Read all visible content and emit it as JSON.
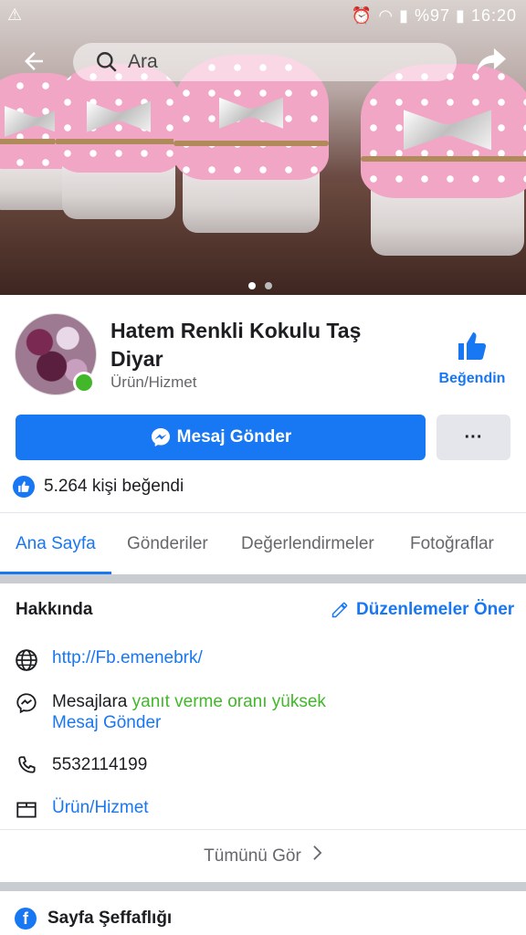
{
  "status_bar": {
    "warning_icon": "⚠",
    "battery": "%97",
    "time": "16:20"
  },
  "search": {
    "placeholder": "Ara"
  },
  "page": {
    "name": "Hatem Renkli Kokulu Taş Diyar",
    "category": "Ürün/Hizmet",
    "liked_label": "Beğendin",
    "message_button": "Mesaj Gönder",
    "more_button": "···",
    "likes_text": "5.264 kişi beğendi"
  },
  "tabs": [
    {
      "label": "Ana Sayfa",
      "active": true
    },
    {
      "label": "Gönderiler",
      "active": false
    },
    {
      "label": "Değerlendirmeler",
      "active": false
    },
    {
      "label": "Fotoğraflar",
      "active": false
    }
  ],
  "about": {
    "title": "Hakkında",
    "suggest_edits": "Düzenlemeler Öner",
    "website": "http://Fb.emenebrk/",
    "messaging_prefix": "Mesajlara",
    "messaging_highlight": "yanıt verme oranı yüksek",
    "messaging_link": "Mesaj Gönder",
    "phone": "5532114199",
    "category_link": "Ürün/Hizmet",
    "see_all": "Tümünü Gör"
  },
  "transparency": {
    "label": "Sayfa Şeffaflığı",
    "icon_letter": "f"
  },
  "colors": {
    "accent": "#1877f2",
    "green": "#42b72a",
    "secondary_text": "#65676b"
  }
}
